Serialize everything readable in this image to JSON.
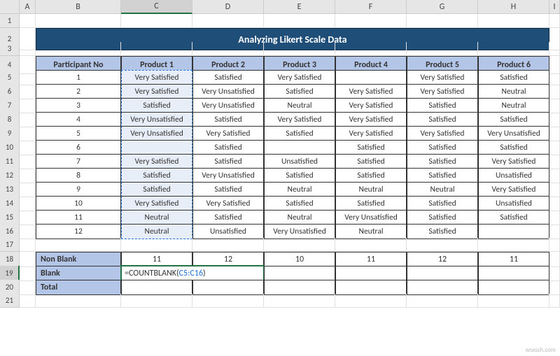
{
  "columns": [
    "A",
    "B",
    "C",
    "D",
    "E",
    "F",
    "G",
    "H",
    "I"
  ],
  "selected_col": "C",
  "rows": [
    "1",
    "2",
    "3",
    "4",
    "5",
    "6",
    "7",
    "8",
    "9",
    "10",
    "11",
    "12",
    "13",
    "14",
    "15",
    "16",
    "17",
    "18",
    "19",
    "20",
    "21"
  ],
  "selected_row": "19",
  "banner": "Analyzing Likert Scale Data",
  "headers": {
    "part": "Participant No",
    "p1": "Product 1",
    "p2": "Product 2",
    "p3": "Product 3",
    "p4": "Product 4",
    "p5": "Product 5",
    "p6": "Product 6"
  },
  "data": [
    {
      "n": "1",
      "p1": "Very Satisfied",
      "p2": "Satisfied",
      "p3": "Very Satisfied",
      "p4": "",
      "p5": "Very Satisfied",
      "p6": "Satisfied"
    },
    {
      "n": "2",
      "p1": "Very Satisfied",
      "p2": "Very Unsatisfied",
      "p3": "Satisfied",
      "p4": "Very Satisfied",
      "p5": "Very Satisfied",
      "p6": "Neutral"
    },
    {
      "n": "3",
      "p1": "Satisfied",
      "p2": "Very Unsatisfied",
      "p3": "Neutral",
      "p4": "Very Satisfied",
      "p5": "Satisfied",
      "p6": "Neutral"
    },
    {
      "n": "4",
      "p1": "Very Unsatisfied",
      "p2": "Satisfied",
      "p3": "Very Satisfied",
      "p4": "Very Satisfied",
      "p5": "Satisfied",
      "p6": "Satisfied"
    },
    {
      "n": "5",
      "p1": "Very Unsatisfied",
      "p2": "Very Satisfied",
      "p3": "Satisfied",
      "p4": "Very Satisfied",
      "p5": "Very Satisfied",
      "p6": "Very Unsatisfied"
    },
    {
      "n": "6",
      "p1": "",
      "p2": "Satisfied",
      "p3": "",
      "p4": "Satisfied",
      "p5": "Satisfied",
      "p6": "Satisfied"
    },
    {
      "n": "7",
      "p1": "Very Satisfied",
      "p2": "Satisfied",
      "p3": "Unsatisfied",
      "p4": "Satisfied",
      "p5": "Satisfied",
      "p6": "Very Satisfied"
    },
    {
      "n": "8",
      "p1": "Satisfied",
      "p2": "Very Unsatisfied",
      "p3": "Satisfied",
      "p4": "Satisfied",
      "p5": "Satisfied",
      "p6": "Unsatisfied"
    },
    {
      "n": "9",
      "p1": "Satisfied",
      "p2": "Satisfied",
      "p3": "Neutral",
      "p4": "Neutral",
      "p5": "Neutral",
      "p6": "Very Satisfied"
    },
    {
      "n": "10",
      "p1": "Very Satisfied",
      "p2": "Very Satisfied",
      "p3": "Satisfied",
      "p4": "Satisfied",
      "p5": "Satisfied",
      "p6": "Unsatisfied"
    },
    {
      "n": "11",
      "p1": "Neutral",
      "p2": "Satisfied",
      "p3": "Neutral",
      "p4": "Very Unsatisfied",
      "p5": "Satisfied",
      "p6": "Satisfied"
    },
    {
      "n": "12",
      "p1": "Neutral",
      "p2": "Unsatisfied",
      "p3": "Very Unsatisfied",
      "p4": "Neutral",
      "p5": "Satisfied",
      "p6": ""
    }
  ],
  "summary": {
    "nonblank_label": "Non Blank",
    "blank_label": "Blank",
    "total_label": "Total",
    "nonblank": {
      "p1": "11",
      "p2": "12",
      "p3": "10",
      "p4": "11",
      "p5": "12",
      "p6": "11"
    }
  },
  "formula": {
    "prefix": "=COUNTBLANK(",
    "ref": "C5:C16",
    "suffix": ")"
  },
  "watermark": "wsxssh.com"
}
